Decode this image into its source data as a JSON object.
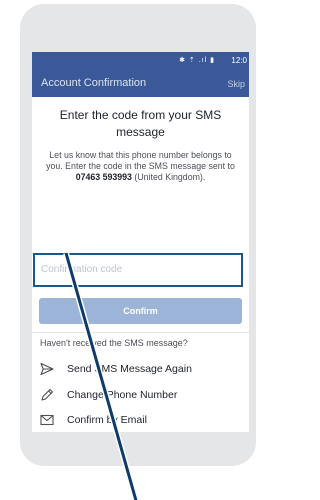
{
  "status_bar": {
    "icons": "✱ ⇡ .ıl ▮",
    "time": "12:0"
  },
  "app_bar": {
    "title": "Account Confirmation",
    "skip_label": "Skip"
  },
  "content": {
    "heading": "Enter the code from your SMS message",
    "desc_prefix": "Let us know that this phone number belongs to you. Enter the code in the SMS message sent to ",
    "phone_number": "07463 593993",
    "desc_suffix": " (United Kingdom).",
    "code_placeholder": "Confirmation code",
    "confirm_label": "Confirm",
    "not_received": "Haven't received the SMS message?",
    "options": [
      {
        "label": "Send SMS Message Again",
        "icon": "send-icon"
      },
      {
        "label": "Change Phone Number",
        "icon": "pencil-icon"
      },
      {
        "label": "Confirm by Email",
        "icon": "envelope-icon"
      }
    ]
  },
  "colors": {
    "brand": "#3b5998",
    "confirm_button": "#9cb4d8",
    "input_highlight": "#1b5a86",
    "pointer": "#0d3b6b"
  }
}
